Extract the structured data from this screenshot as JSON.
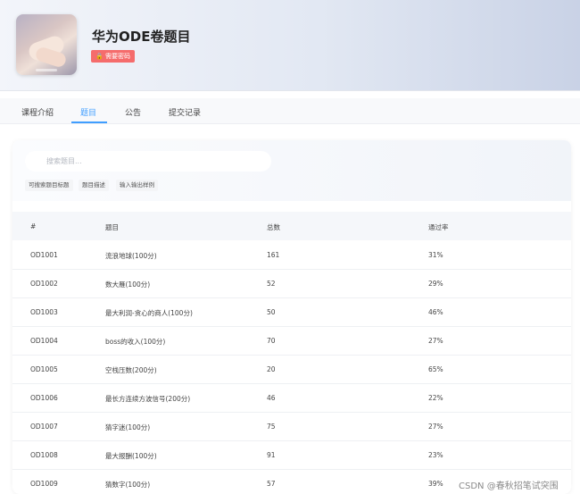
{
  "course": {
    "title": "华为ODE卷题目",
    "badge": "需要密码"
  },
  "tabs": [
    "课程介绍",
    "题目",
    "公告",
    "提交记录"
  ],
  "active_tab": "题目",
  "search": {
    "placeholder": "搜索题目...",
    "chips": [
      "可搜索题目标题",
      "题目描述",
      "输入输出样例"
    ]
  },
  "table": {
    "headers": [
      "#",
      "题目",
      "总数",
      "通过率"
    ],
    "rows": [
      [
        "OD1001",
        "流浪地球(100分)",
        "161",
        "31%"
      ],
      [
        "OD1002",
        "数大雁(100分)",
        "52",
        "29%"
      ],
      [
        "OD1003",
        "最大利润-贪心的商人(100分)",
        "50",
        "46%"
      ],
      [
        "OD1004",
        "boss的收入(100分)",
        "70",
        "27%"
      ],
      [
        "OD1005",
        "空栈压数(200分)",
        "20",
        "65%"
      ],
      [
        "OD1006",
        "最长方连续方波信号(200分)",
        "46",
        "22%"
      ],
      [
        "OD1007",
        "猜字迷(100分)",
        "75",
        "27%"
      ],
      [
        "OD1008",
        "最大报酬(100分)",
        "91",
        "23%"
      ],
      [
        "OD1009",
        "猜数字(100分)",
        "57",
        "39%"
      ]
    ]
  },
  "watermark": "CSDN @春秋招笔试突围",
  "colors": {
    "accent": "#409eff",
    "badge": "#f56c6c"
  }
}
